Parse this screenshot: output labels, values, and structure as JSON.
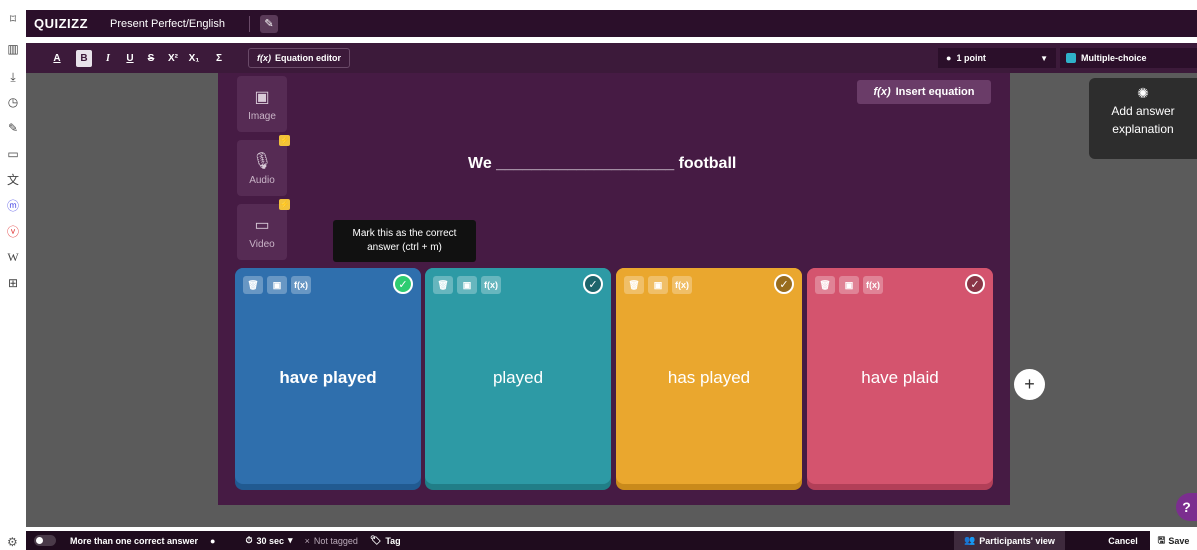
{
  "header": {
    "logo": "QUIZIZZ",
    "quiz_title": "Present Perfect/English",
    "edit_icon": "pencil-icon"
  },
  "toolbar": {
    "format_buttons": [
      "A",
      "B",
      "I",
      "U",
      "S",
      "X²",
      "X₁",
      "Σ"
    ],
    "equation_editor_label": "Equation editor",
    "points_label": "1 point",
    "question_type_label": "Multiple-choice"
  },
  "sidebar": {
    "icons": [
      "bookmark-icon",
      "reader-icon",
      "download-icon",
      "history-icon",
      "edit-icon",
      "calendar-icon",
      "translate-icon",
      "mastodon-icon",
      "vivaldi-icon",
      "wikipedia-icon",
      "add-panel-icon"
    ]
  },
  "media": {
    "image_label": "Image",
    "audio_label": "Audio",
    "video_label": "Video"
  },
  "question": {
    "insert_equation_label": "Insert equation",
    "text": "We ____________________ football"
  },
  "tooltip": {
    "text": "Mark this as the correct answer (ctrl + m)"
  },
  "answers": [
    {
      "label": "have played",
      "color": "#2f6fad",
      "bottom": "#215a91",
      "correct": true
    },
    {
      "label": "played",
      "color": "#2d9aa5",
      "bottom": "#217e87",
      "correct": false
    },
    {
      "label": "has played",
      "color": "#eaa72e",
      "bottom": "#c98a1b",
      "correct": false
    },
    {
      "label": "have plaid",
      "color": "#d4546e",
      "bottom": "#b23f58",
      "correct": false
    }
  ],
  "explanation": {
    "label_line1": "Add answer",
    "label_line2": "explanation"
  },
  "help_label": "?",
  "footer": {
    "multi_correct_label": "More than one correct answer",
    "time_label": "30 sec",
    "not_tagged_label": "Not tagged",
    "tag_label": "Tag",
    "participants_view_label": "Participants' view",
    "cancel_label": "Cancel",
    "save_label": "Save"
  }
}
